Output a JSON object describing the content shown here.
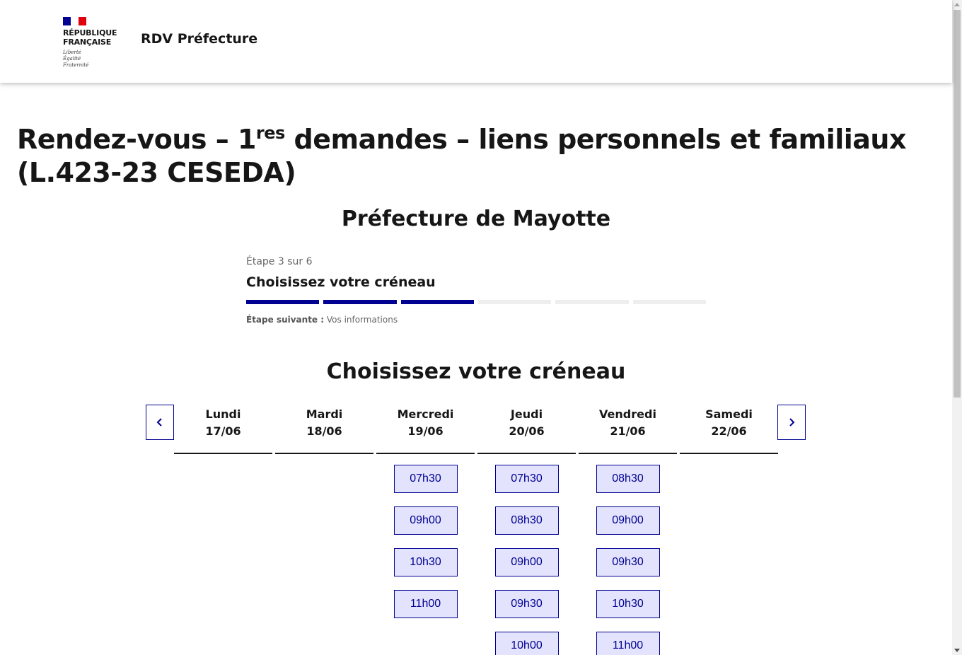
{
  "header": {
    "republic_line1": "République",
    "republic_line2": "Française",
    "motto_1": "Liberté",
    "motto_2": "Égalité",
    "motto_3": "Fraternité",
    "service_title": "RDV Préfecture"
  },
  "page": {
    "title_part1": "Rendez-vous – 1",
    "title_sup": "res",
    "title_part2": " demandes – liens personnels et familiaux (L.423-23 CESEDA)",
    "prefecture": "Préfecture de Mayotte"
  },
  "stepper": {
    "state": "Étape 3 sur 6",
    "title": "Choisissez votre créneau",
    "current_step": 3,
    "total_steps": 6,
    "next_label": "Étape suivante :",
    "next_value": "Vos informations"
  },
  "calendar": {
    "heading": "Choisissez votre créneau",
    "prev_icon": "chevron-left-icon",
    "next_icon": "chevron-right-icon",
    "days": [
      {
        "name": "Lundi",
        "date": "17/06",
        "slots": []
      },
      {
        "name": "Mardi",
        "date": "18/06",
        "slots": []
      },
      {
        "name": "Mercredi",
        "date": "19/06",
        "slots": [
          "07h30",
          "09h00",
          "10h30",
          "11h00"
        ]
      },
      {
        "name": "Jeudi",
        "date": "20/06",
        "slots": [
          "07h30",
          "08h30",
          "09h00",
          "09h30",
          "10h00"
        ]
      },
      {
        "name": "Vendredi",
        "date": "21/06",
        "slots": [
          "08h30",
          "09h00",
          "09h30",
          "10h30",
          "11h00"
        ]
      },
      {
        "name": "Samedi",
        "date": "22/06",
        "slots": []
      }
    ]
  },
  "colors": {
    "accent": "#000091",
    "slot_background": "#e3e3fd",
    "flag_red": "#e1000f"
  }
}
